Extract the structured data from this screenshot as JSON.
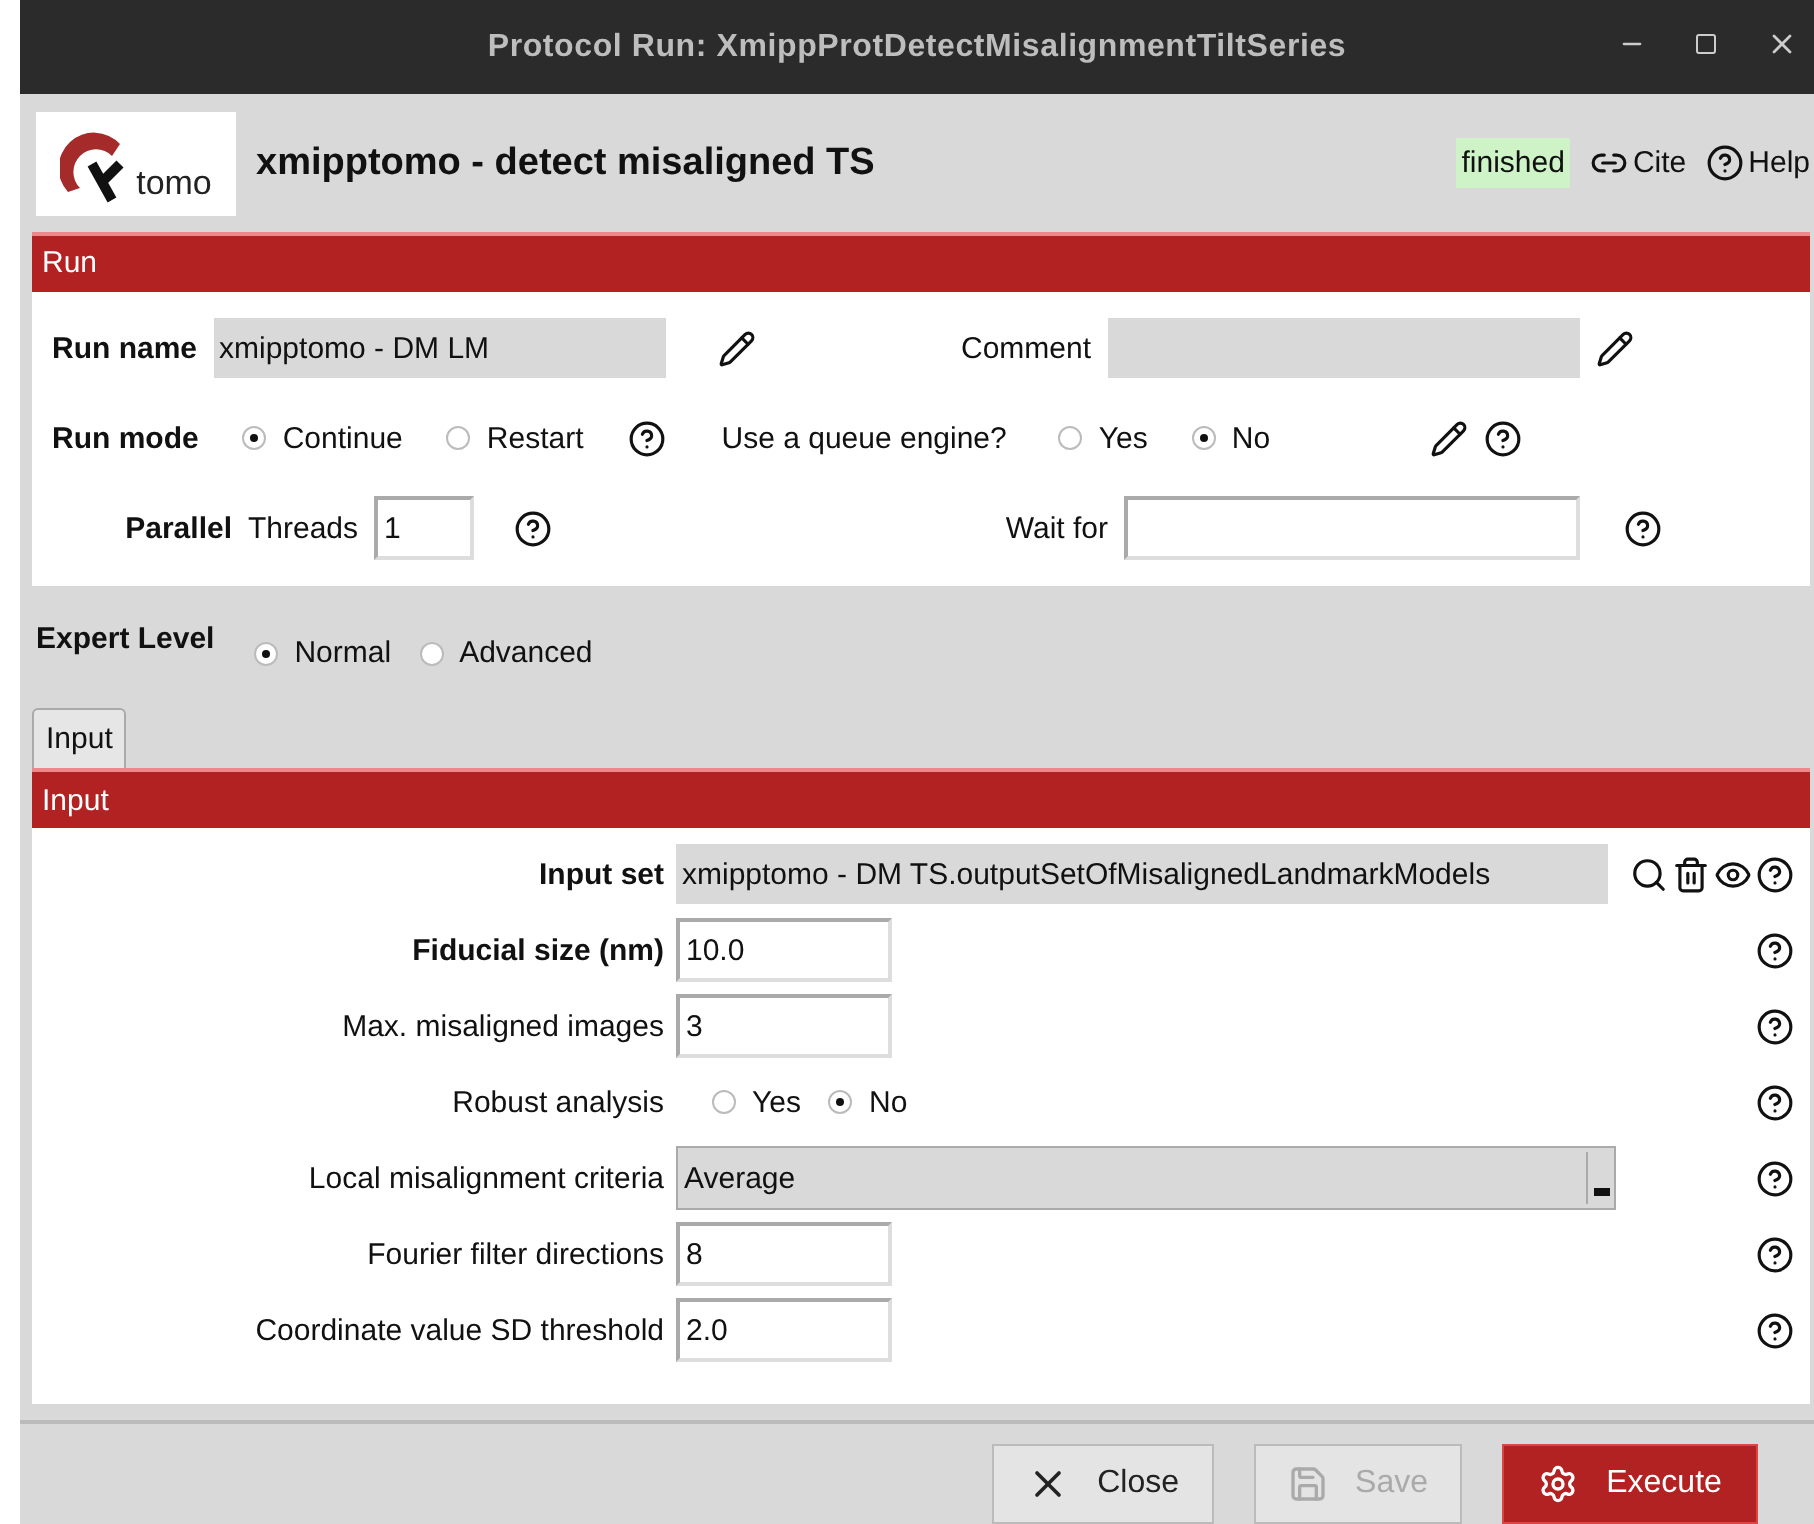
{
  "window": {
    "title": "Protocol Run: XmippProtDetectMisalignmentTiltSeries"
  },
  "header": {
    "logo_text": "tomo",
    "title": "xmipptomo - detect misaligned TS",
    "status": "finished",
    "cite": "Cite",
    "help": "Help"
  },
  "run_section": {
    "title": "Run",
    "run_name": {
      "label": "Run name",
      "value": "xmipptomo - DM LM"
    },
    "comment": {
      "label": "Comment"
    },
    "run_mode": {
      "label": "Run mode",
      "options": [
        {
          "label": "Continue",
          "selected": true
        },
        {
          "label": "Restart",
          "selected": false
        }
      ]
    },
    "queue": {
      "label": "Use a queue engine?",
      "options": [
        {
          "label": "Yes",
          "selected": false
        },
        {
          "label": "No",
          "selected": true
        }
      ]
    },
    "parallel": {
      "label": "Parallel",
      "threads_label": "Threads",
      "threads_value": "1"
    },
    "wait_for": {
      "label": "Wait for"
    }
  },
  "expert_level": {
    "label": "Expert Level",
    "options": [
      {
        "label": "Normal",
        "selected": true
      },
      {
        "label": "Advanced",
        "selected": false
      }
    ]
  },
  "tabs": [
    {
      "label": "Input",
      "selected": true
    }
  ],
  "input_section": {
    "title": "Input",
    "params": [
      {
        "kind": "pointer",
        "label": "Input set",
        "bold": true,
        "value": "xmipptomo - DM TS.outputSetOfMisalignedLandmarkModels"
      },
      {
        "kind": "text",
        "label": "Fiducial size (nm)",
        "bold": true,
        "value": "10.0"
      },
      {
        "kind": "text",
        "label": "Max. misaligned images",
        "bold": false,
        "value": "3"
      },
      {
        "kind": "radio",
        "label": "Robust analysis",
        "bold": false,
        "options": [
          {
            "label": "Yes",
            "selected": false
          },
          {
            "label": "No",
            "selected": true
          }
        ]
      },
      {
        "kind": "select",
        "label": "Local misalignment criteria",
        "bold": false,
        "value": "Average"
      },
      {
        "kind": "text",
        "label": "Fourier filter directions",
        "bold": false,
        "value": "8"
      },
      {
        "kind": "text",
        "label": "Coordinate value SD threshold",
        "bold": false,
        "value": "2.0"
      }
    ]
  },
  "buttons": [
    {
      "kind": "close",
      "label": "Close",
      "disabled": false
    },
    {
      "kind": "save",
      "label": "Save",
      "disabled": true
    },
    {
      "kind": "execute",
      "label": "Execute",
      "disabled": false
    }
  ]
}
